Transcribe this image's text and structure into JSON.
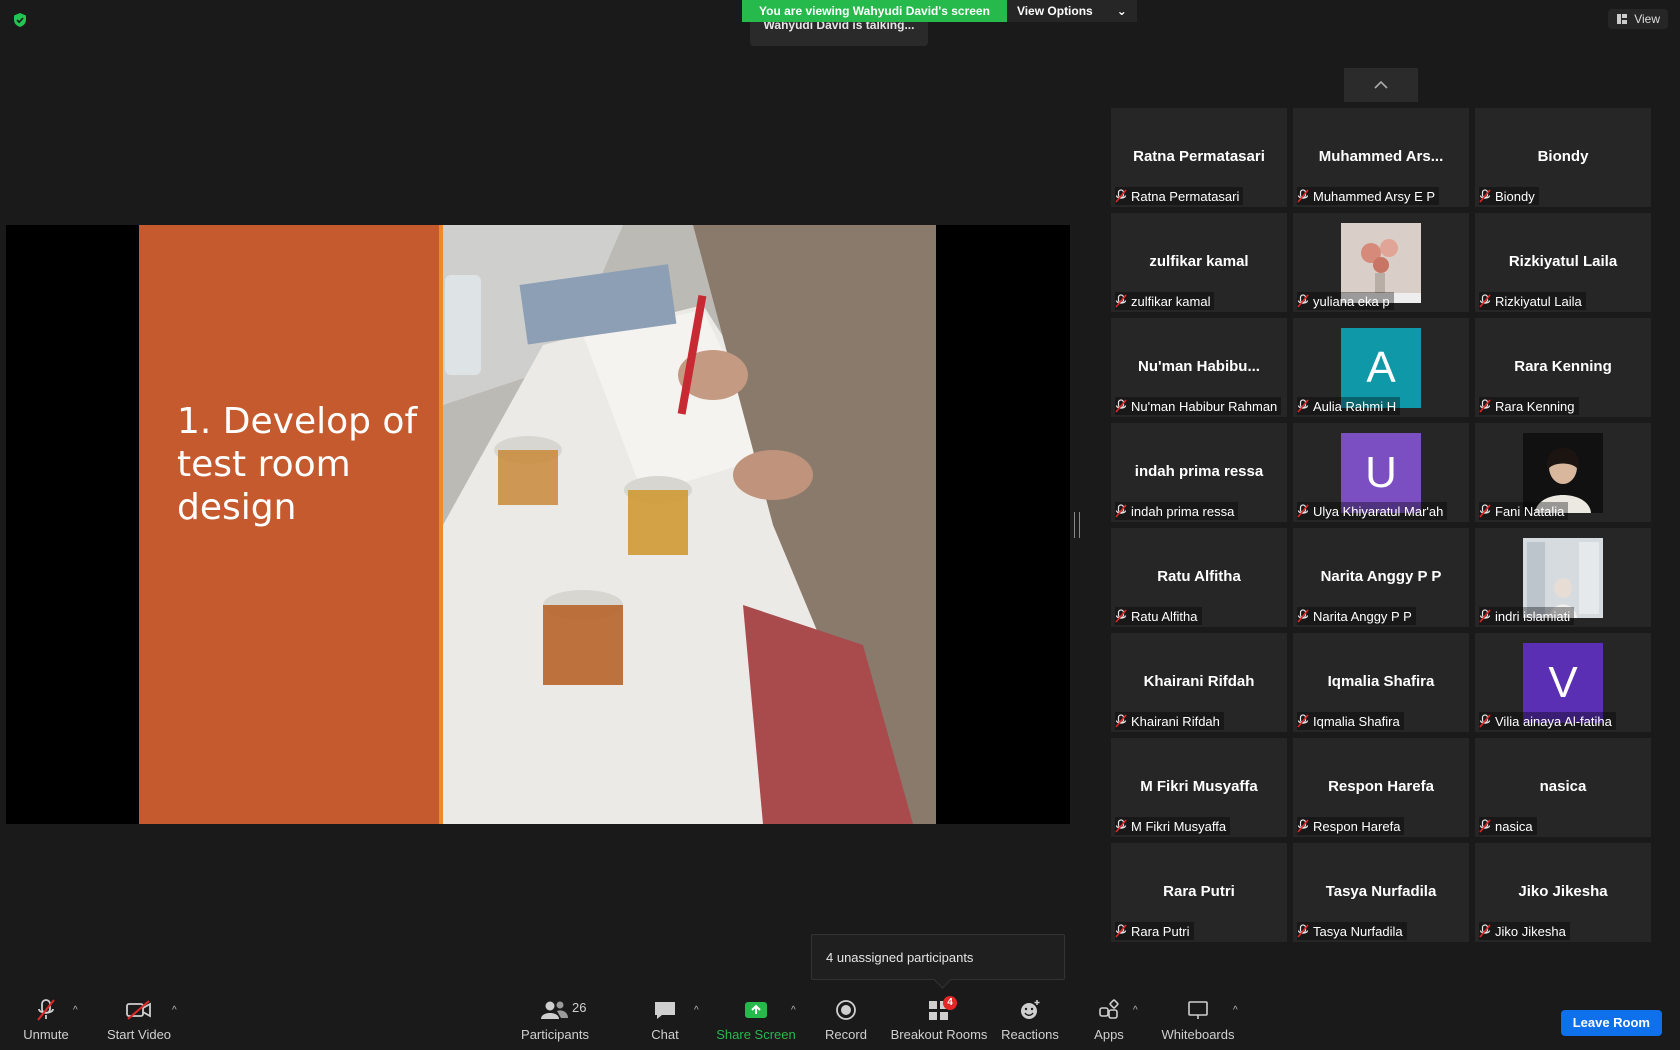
{
  "banner": {
    "viewing_text": "You are viewing Wahyudi David's screen",
    "view_options_label": "View Options"
  },
  "talking_text": "Wahyudi David is talking...",
  "view_button_label": "View",
  "slide": {
    "title": "1. Develop of test room design"
  },
  "participants": [
    {
      "display": "Ratna Permatasari",
      "caption": "Ratna Permatasari"
    },
    {
      "display": "Muhammed  Ars...",
      "caption": "Muhammed Arsy E P"
    },
    {
      "display": "Biondy",
      "caption": "Biondy"
    },
    {
      "display": "zulfikar kamal",
      "caption": "zulfikar kamal"
    },
    {
      "display": "",
      "caption": "yuliana eka p"
    },
    {
      "display": "Rizkiyatul Laila",
      "caption": "Rizkiyatul Laila"
    },
    {
      "display": "Nu'man  Habibu...",
      "caption": "Nu'man Habibur Rahman"
    },
    {
      "display": "A",
      "caption": "Aulia Rahmi H"
    },
    {
      "display": "Rara Kenning",
      "caption": "Rara Kenning"
    },
    {
      "display": "indah prima ressa",
      "caption": "indah prima ressa"
    },
    {
      "display": "U",
      "caption": "Ulya Khiyaratul Mar'ah"
    },
    {
      "display": "",
      "caption": "Fani Natalia"
    },
    {
      "display": "Ratu Alfitha",
      "caption": "Ratu Alfitha"
    },
    {
      "display": "Narita Anggy P P",
      "caption": "Narita Anggy P P"
    },
    {
      "display": "",
      "caption": "indri islamiati"
    },
    {
      "display": "Khairani Rifdah",
      "caption": "Khairani Rifdah"
    },
    {
      "display": "Iqmalia Shafira",
      "caption": "Iqmalia Shafira"
    },
    {
      "display": "V",
      "caption": "Vilia ainaya Al-fatiha"
    },
    {
      "display": "M Fikri Musyaffa",
      "caption": "M Fikri Musyaffa"
    },
    {
      "display": "Respon Harefa",
      "caption": "Respon Harefa"
    },
    {
      "display": "nasica",
      "caption": "nasica"
    },
    {
      "display": "Rara Putri",
      "caption": "Rara Putri"
    },
    {
      "display": "Tasya Nurfadila",
      "caption": "Tasya Nurfadila"
    },
    {
      "display": "Jiko Jikesha",
      "caption": "Jiko Jikesha"
    }
  ],
  "avatar_colors": {
    "A": "#0e98a8",
    "U": "#7b4fc2",
    "V": "#5a2fb3"
  },
  "popup_text": "4 unassigned participants",
  "toolbar": {
    "unmute": "Unmute",
    "start_video": "Start Video",
    "participants": "Participants",
    "participants_count": "26",
    "chat": "Chat",
    "share_screen": "Share Screen",
    "record": "Record",
    "breakout_rooms": "Breakout Rooms",
    "breakout_badge": "4",
    "reactions": "Reactions",
    "apps": "Apps",
    "whiteboards": "Whiteboards",
    "leave_room": "Leave Room"
  },
  "colors": {
    "share_green": "#26b94c",
    "leave_blue": "#0e71eb",
    "slide_orange": "#c55a2e"
  }
}
